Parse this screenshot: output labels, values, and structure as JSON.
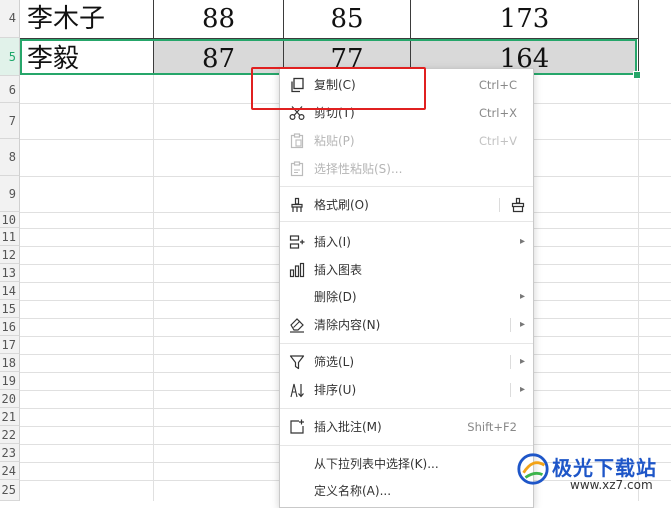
{
  "sheet": {
    "row_headers": [
      "4",
      "5",
      "6",
      "7",
      "8",
      "9",
      "10",
      "11",
      "12",
      "13",
      "14",
      "15",
      "16",
      "17",
      "18",
      "19",
      "20",
      "21",
      "22",
      "23",
      "24",
      "25"
    ],
    "rows": [
      {
        "name": "李木子",
        "c": "88",
        "d": "85",
        "e": "173"
      },
      {
        "name": "李毅",
        "c": "87",
        "d": "77",
        "e": "164"
      }
    ]
  },
  "context_menu": {
    "items": {
      "copy": {
        "label": "复制(C)",
        "shortcut": "Ctrl+C",
        "icon": "copy-icon"
      },
      "cut": {
        "label": "剪切(T)",
        "shortcut": "Ctrl+X",
        "icon": "scissors-icon"
      },
      "paste": {
        "label": "粘贴(P)",
        "shortcut": "Ctrl+V",
        "icon": "paste-icon"
      },
      "paste_special": {
        "label": "选择性粘贴(S)...",
        "icon": "paste-special-icon"
      },
      "format_painter": {
        "label": "格式刷(O)",
        "icon": "format-brush-icon"
      },
      "insert": {
        "label": "插入(I)",
        "icon": "insert-row-icon"
      },
      "insert_chart": {
        "label": "插入图表",
        "icon": "bar-chart-icon"
      },
      "delete": {
        "label": "删除(D)"
      },
      "clear": {
        "label": "清除内容(N)",
        "icon": "eraser-icon"
      },
      "filter": {
        "label": "筛选(L)",
        "icon": "filter-funnel-icon"
      },
      "sort": {
        "label": "排序(U)",
        "icon": "sort-icon"
      },
      "insert_comment": {
        "label": "插入批注(M)",
        "shortcut": "Shift+F2",
        "icon": "comment-icon"
      },
      "pick_from_list": {
        "label": "从下拉列表中选择(K)..."
      },
      "define_name": {
        "label": "定义名称(A)..."
      }
    }
  },
  "watermark": {
    "title": "极光下载站",
    "url": "www.xz7.com"
  },
  "colors": {
    "selection": "#26a66a",
    "highlight_box": "#e02020",
    "selected_fill": "#d9d9d9",
    "watermark_blue": "#1e56c8"
  }
}
